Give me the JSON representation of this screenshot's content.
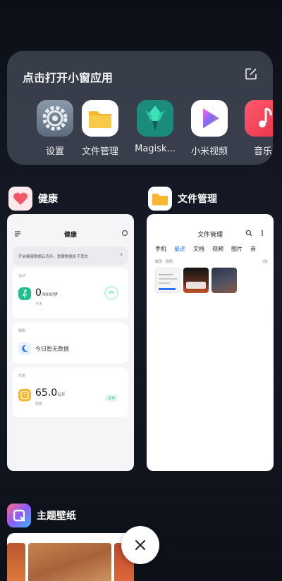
{
  "floating_panel": {
    "title": "点击打开小窗应用",
    "apps": [
      {
        "label": "设置",
        "icon": "settings-icon"
      },
      {
        "label": "文件管理",
        "icon": "files-icon"
      },
      {
        "label": "Magisk...",
        "icon": "magisk-icon"
      },
      {
        "label": "小米视频",
        "icon": "mi-video-icon"
      },
      {
        "label": "音乐",
        "icon": "music-icon"
      }
    ]
  },
  "recent_cards": [
    {
      "app_name": "健康",
      "screen": {
        "title": "健康",
        "banner": "开启健康数据云同步，重要数据永不丢失",
        "sections": [
          {
            "label": "运动",
            "value": "0",
            "unit": "/9000步",
            "sub": "今天",
            "badge": "0%"
          },
          {
            "label": "睡眠",
            "text": "今日暂无数据"
          },
          {
            "label": "体重",
            "value": "65.0",
            "unit": "公斤",
            "sub": "刚刚",
            "badge": "正常"
          }
        ]
      }
    },
    {
      "app_name": "文件管理",
      "screen": {
        "title": "文件管理",
        "tabs": [
          "手机",
          "最近",
          "文档",
          "视频",
          "图片",
          "音"
        ],
        "active_tab": "最近",
        "subtitle": "截屏 · 刚刚",
        "count": "3张"
      }
    },
    {
      "app_name": "主题壁纸"
    }
  ],
  "colors": {
    "accent_blue": "#2a76f0",
    "health_green": "#1fbf8f",
    "files_yellow": "#f7b731"
  }
}
